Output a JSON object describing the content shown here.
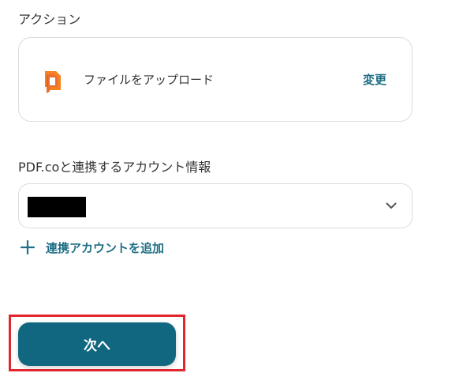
{
  "action_section": {
    "label": "アクション",
    "card": {
      "app_icon": "pdfco-logo-icon",
      "action_name": "ファイルをアップロード",
      "change_label": "変更"
    }
  },
  "account_section": {
    "label": "PDF.coと連携するアカウント情報",
    "select": {
      "selected_value": "",
      "redacted": true,
      "icon": "chevron-down-icon"
    },
    "add_account_label": "連携アカウントを追加",
    "add_account_icon": "plus-icon"
  },
  "footer": {
    "next_label": "次へ",
    "highlight_color": "#e3262e"
  },
  "colors": {
    "accent": "#10677f",
    "link": "#1f6f86",
    "brand_icon": "#f26522"
  }
}
